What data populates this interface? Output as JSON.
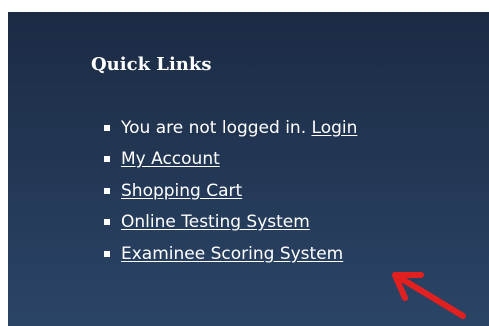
{
  "quick_links": {
    "title": "Quick Links",
    "login_status": "You are not logged in.",
    "items": [
      {
        "label": "Login"
      },
      {
        "label": "My Account"
      },
      {
        "label": "Shopping Cart"
      },
      {
        "label": "Online Testing System"
      },
      {
        "label": "Examinee Scoring System"
      }
    ]
  },
  "annotation": {
    "arrow_color": "#e32020",
    "arrow_icon": "red-arrow-icon"
  },
  "colors": {
    "panel_top": "#1c2b44",
    "panel_bottom": "#2b4567",
    "text": "#ffffff"
  }
}
